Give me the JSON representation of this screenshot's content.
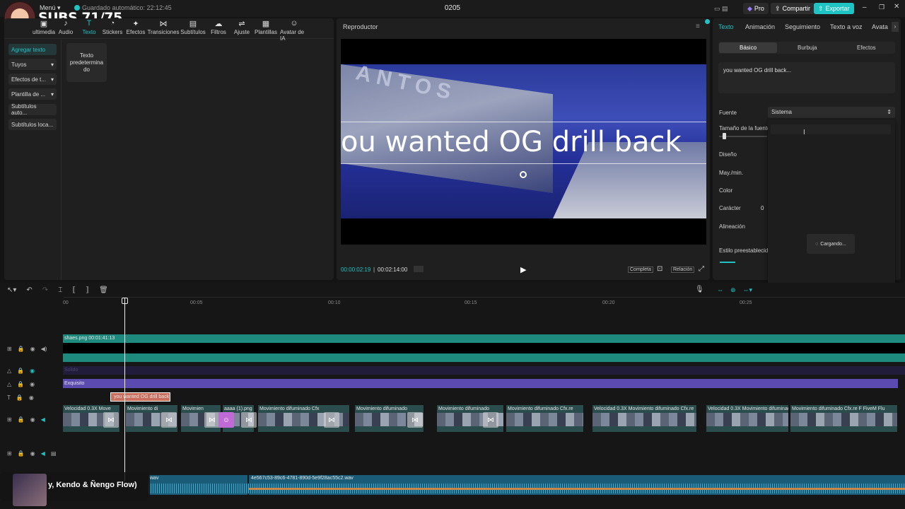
{
  "topbar": {
    "menu": "Menú",
    "autosave": "Guardado automático: 22:12:45",
    "project_name": "0205",
    "pro": "Pro",
    "share": "Compartir",
    "export": "Exportar"
  },
  "overlay": {
    "subs": "SUBS 71/75",
    "now_playing": "y, Kendo & Ñengo Flow)"
  },
  "toolbar": {
    "items": [
      "ultimedia",
      "Audio",
      "Texto",
      "Stickers",
      "Efectos",
      "Transiciones",
      "Subtítulos",
      "Filtros",
      "Ajuste",
      "Plantillas",
      "Avatar de IA"
    ]
  },
  "left_sidebar": {
    "items": [
      "Agregar texto",
      "Tuyos",
      "Efectos de t...",
      "Plantilla de ...",
      "Subtítulos auto...",
      "Subtítulos loca..."
    ]
  },
  "asset": {
    "default_text": "Texto predetermina do"
  },
  "player": {
    "title": "Reproductor",
    "overlay_text": "ou wanted OG drill back",
    "current_time": "00:00:02:19",
    "total_time": "00:02:14:00",
    "full_label": "Completa",
    "ratio_label": "Relación"
  },
  "right_panel": {
    "tabs": [
      "Texto",
      "Animación",
      "Seguimiento",
      "Texto a voz",
      "Avata"
    ],
    "subtabs": [
      "Básico",
      "Burbuja",
      "Efectos"
    ],
    "text_value": "you wanted OG drill back...",
    "font_label": "Fuente",
    "font_value": "Sistema",
    "size_label": "Tamaño de la fuente",
    "design_label": "Diseño",
    "case_label": "May./min.",
    "color_label": "Color",
    "char_label": "Carácter",
    "char_value": "0",
    "align_label": "Alineación",
    "preset_label": "Estilo preestablecido",
    "loading": "Cargando..."
  },
  "timeline": {
    "ruler": [
      "00",
      "00:05",
      "00:10",
      "00:15",
      "00:20",
      "00:25"
    ],
    "overlay_clip": "shaes.png  00:01:41:13",
    "faded_clip": "Solido",
    "effect_clip": "Exquisito",
    "text_clip": "you wanted OG drill back",
    "video_clips": [
      "Velocidad 0.3X  Move",
      "Movimiento di",
      "Movimien",
      "aaaa (1).png",
      "Movimiento difuminado  Cfx",
      "Movimiento difuminado",
      "Movimiento difuminado",
      "Movimiento difuminado  Cfx.re",
      "Velocidad 0.3X  Movimiento difuminado  Cfx.re",
      "Velocidad 0.3X  Movimiento difuminado",
      "Movimiento difuminado  Cfx.re  F  FiveM  Flu"
    ],
    "audio_clip_1": "wav",
    "audio_clip_2": "4e567c53-89c6-4781-890d-5e9f28ac55c2.wav"
  },
  "colors": {
    "accent": "#1fc3c3",
    "track_teal": "#1e8a7e",
    "purple": "#5b4bb0",
    "text_clip": "#c96d5c"
  }
}
